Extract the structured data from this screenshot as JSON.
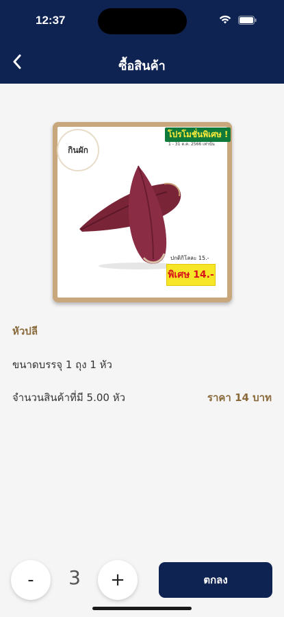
{
  "status_bar": {
    "time": "12:37",
    "icons": [
      "wifi-icon",
      "battery-icon"
    ]
  },
  "header": {
    "title": "ซื้อสินค้า",
    "back_icon": "chevron-left-icon"
  },
  "product_image": {
    "brand": "กินผัก",
    "promo_title": "โปรโมชั่นพิเศษ !",
    "promo_date": "1 - 31 ต.ค. 2566 เท่านั้น",
    "normal_price": "ปกติกิโลละ 15.-",
    "special_price": "พิเศษ 14.-"
  },
  "product": {
    "name": "หัวปลี",
    "package": "ขนาดบรรจุ 1 ถุง 1 หัว",
    "stock": "จำนวนสินค้าที่มี 5.00 หัว",
    "price": "ราคา 14 บาท"
  },
  "controls": {
    "minus_label": "-",
    "quantity": "3",
    "plus_label": "+",
    "ok_label": "ตกลง"
  },
  "colors": {
    "header_bg": "#0f2352",
    "accent_text": "#8a6a3a",
    "button_bg": "#0f2352"
  }
}
